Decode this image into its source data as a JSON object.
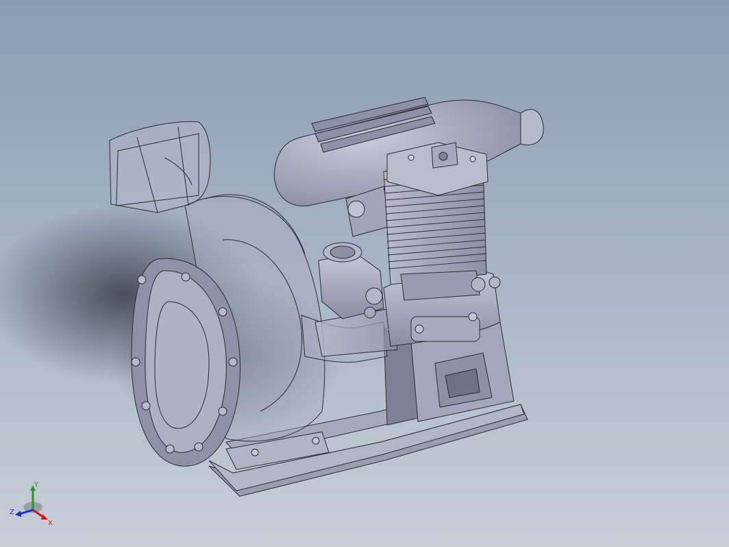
{
  "view": {
    "background_top": "#8a9cb2",
    "background_bottom": "#c8ced8",
    "part_color": "#a2a5b8",
    "edge_color": "#2a2a36"
  },
  "triad": {
    "x_label": "X",
    "y_label": "Y",
    "z_label": "Z",
    "x_color": "#d01818",
    "y_color": "#17a017",
    "z_color": "#1a2ad0"
  }
}
